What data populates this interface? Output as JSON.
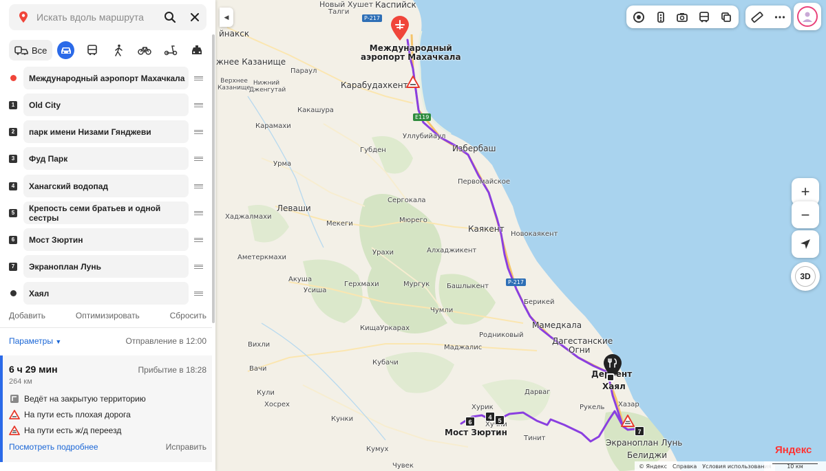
{
  "search": {
    "placeholder": "Искать вдоль маршрута"
  },
  "modes": {
    "all_label": "Все",
    "items": [
      "all",
      "car",
      "bus",
      "walk",
      "bike",
      "scooter",
      "taxi"
    ],
    "active": "car"
  },
  "waypoints": [
    {
      "marker": "start",
      "label": "Международный аэропорт Махачкала"
    },
    {
      "marker": "1",
      "label": "Old City"
    },
    {
      "marker": "2",
      "label": "парк имени Низами Гянджеви"
    },
    {
      "marker": "3",
      "label": "Фуд Парк"
    },
    {
      "marker": "4",
      "label": "Ханагский водопад"
    },
    {
      "marker": "5",
      "label": "Крепость семи братьев и одной сестры"
    },
    {
      "marker": "6",
      "label": "Мост Зюртин"
    },
    {
      "marker": "7",
      "label": "Экраноплан Лунь"
    },
    {
      "marker": "end",
      "label": "Хаял"
    }
  ],
  "actions": {
    "add": "Добавить",
    "optimize": "Оптимизировать",
    "reset": "Сбросить"
  },
  "params": {
    "label": "Параметры",
    "departure": "Отправление в 12:00"
  },
  "route": {
    "duration": "6 ч 29 мин",
    "arrival": "Прибытие в 18:28",
    "distance": "264 км",
    "warnings": [
      "Ведёт на закрытую территорию",
      "На пути есть плохая дорога",
      "На пути есть ж/д переезд"
    ],
    "more_link": "Посмотреть подробнее",
    "fix_link": "Исправить"
  },
  "map": {
    "labels": [
      {
        "text": "Новый Хушет",
        "cls": ""
      },
      {
        "text": "Каспийск",
        "cls": "big"
      },
      {
        "text": "Талги",
        "cls": ""
      },
      {
        "text": "йнакск",
        "cls": "big"
      },
      {
        "text": "жнее Казанище",
        "cls": "big"
      },
      {
        "text": "Парaул",
        "cls": ""
      },
      {
        "text": "Верхнее Казанище",
        "cls": ""
      },
      {
        "text": "Нижний Дженгутай",
        "cls": ""
      },
      {
        "text": "Карабудахкент",
        "cls": "big"
      },
      {
        "text": "Какашура",
        "cls": ""
      },
      {
        "text": "Карамахи",
        "cls": ""
      },
      {
        "text": "Уллубийаул",
        "cls": ""
      },
      {
        "text": "Избербаш",
        "cls": "big"
      },
      {
        "text": "Губден",
        "cls": ""
      },
      {
        "text": "Урма",
        "cls": ""
      },
      {
        "text": "Первомайское",
        "cls": ""
      },
      {
        "text": "Сергокала",
        "cls": ""
      },
      {
        "text": "Леваши",
        "cls": "big"
      },
      {
        "text": "Хаджалмахи",
        "cls": ""
      },
      {
        "text": "Мекеги",
        "cls": ""
      },
      {
        "text": "Мюрего",
        "cls": ""
      },
      {
        "text": "Каякент",
        "cls": "big"
      },
      {
        "text": "Новокаякент",
        "cls": ""
      },
      {
        "text": "Урахи",
        "cls": ""
      },
      {
        "text": "Алхаджикент",
        "cls": ""
      },
      {
        "text": "Аметеркмахи",
        "cls": ""
      },
      {
        "text": "Акуша",
        "cls": ""
      },
      {
        "text": "Усиша",
        "cls": ""
      },
      {
        "text": "Герхмахи",
        "cls": ""
      },
      {
        "text": "Мургук",
        "cls": ""
      },
      {
        "text": "Башлыкент",
        "cls": ""
      },
      {
        "text": "Берикей",
        "cls": ""
      },
      {
        "text": "Чумли",
        "cls": ""
      },
      {
        "text": "Мамедкала",
        "cls": "big"
      },
      {
        "text": "Кища",
        "cls": ""
      },
      {
        "text": "Уркарах",
        "cls": ""
      },
      {
        "text": "Родниковый",
        "cls": ""
      },
      {
        "text": "Вихли",
        "cls": ""
      },
      {
        "text": "Маджалис",
        "cls": ""
      },
      {
        "text": "Дагестанские",
        "cls": "big"
      },
      {
        "text": "Огни",
        "cls": "big"
      },
      {
        "text": "Кубачи",
        "cls": ""
      },
      {
        "text": "Вачи",
        "cls": ""
      },
      {
        "text": "Дербент",
        "cls": "strong"
      },
      {
        "text": "Хаял",
        "cls": "strong"
      },
      {
        "text": "Кули",
        "cls": ""
      },
      {
        "text": "Дарваг",
        "cls": ""
      },
      {
        "text": "Хосрех",
        "cls": ""
      },
      {
        "text": "Хазар",
        "cls": ""
      },
      {
        "text": "Рукель",
        "cls": ""
      },
      {
        "text": "Хурик",
        "cls": ""
      },
      {
        "text": "Хучни",
        "cls": ""
      },
      {
        "text": "Кунки",
        "cls": ""
      },
      {
        "text": "Тинит",
        "cls": ""
      },
      {
        "text": "Мост Зюртин",
        "cls": "strong"
      },
      {
        "text": "Экраноплан Лунь",
        "cls": "big"
      },
      {
        "text": "Белиджи",
        "cls": "big"
      },
      {
        "text": "Кумух",
        "cls": ""
      },
      {
        "text": "Чувек",
        "cls": ""
      }
    ],
    "airport_label": "Международный\nаэропорт Махачкала",
    "shields": [
      {
        "text": "Р-217",
        "color": "blue"
      },
      {
        "text": "E119",
        "color": "green"
      },
      {
        "text": "Р-217",
        "color": "blue"
      }
    ],
    "route_color": "#8a3fe0",
    "water_color": "#a9d3ee",
    "controls": {
      "zoom_in": "+",
      "zoom_out": "−",
      "three_d": "3D"
    },
    "logo": "Яндекс",
    "copyright": [
      "© Яндекс",
      "Справка",
      "Условия использования"
    ],
    "scale": "10 км"
  }
}
